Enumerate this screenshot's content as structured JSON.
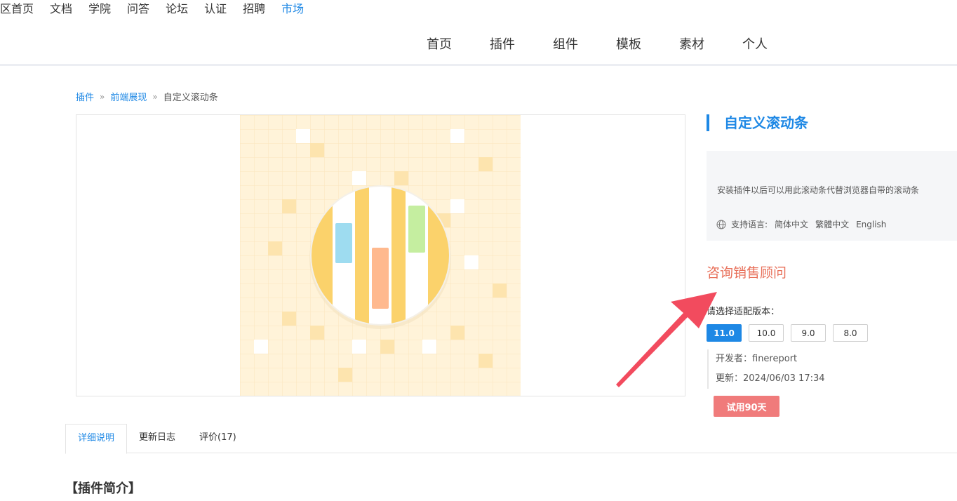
{
  "top_nav": {
    "items": [
      {
        "label": "区首页"
      },
      {
        "label": "文档"
      },
      {
        "label": "学院"
      },
      {
        "label": "问答"
      },
      {
        "label": "论坛"
      },
      {
        "label": "认证"
      },
      {
        "label": "招聘"
      },
      {
        "label": "市场",
        "active": true
      }
    ]
  },
  "main_nav": {
    "items": [
      {
        "label": "首页"
      },
      {
        "label": "插件"
      },
      {
        "label": "组件"
      },
      {
        "label": "模板"
      },
      {
        "label": "素材"
      },
      {
        "label": "个人"
      }
    ]
  },
  "breadcrumb": {
    "items": [
      "插件",
      "前端展现"
    ],
    "separator": "»",
    "current": "自定义滚动条"
  },
  "plugin": {
    "title": "自定义滚动条",
    "description": "安装插件以后可以用此滚动条代替浏览器自带的滚动条",
    "language_label": "支持语言:",
    "languages": [
      "简体中文",
      "繁體中文",
      "English"
    ],
    "consult_label": "咨询销售顾问",
    "version_label": "请选择适配版本：",
    "versions": [
      "11.0",
      "10.0",
      "9.0",
      "8.0"
    ],
    "selected_version": "11.0",
    "developer": "开发者：finereport",
    "updated": "更新：2024/06/03 17:34",
    "trial_label": "试用90天"
  },
  "tabs": [
    {
      "label": "详细说明",
      "active": true
    },
    {
      "label": "更新日志"
    },
    {
      "label": "评价(17)"
    }
  ],
  "intro": {
    "title": "【插件简介】"
  },
  "colors": {
    "accent": "#1e88e5",
    "consult": "#e8705a",
    "trial": "#f07b7b",
    "arrow": "#f24b5e",
    "preview_bg": "#fff3d9"
  },
  "icons": {
    "globe": "globe-icon",
    "arrow": "annotation-arrow"
  }
}
